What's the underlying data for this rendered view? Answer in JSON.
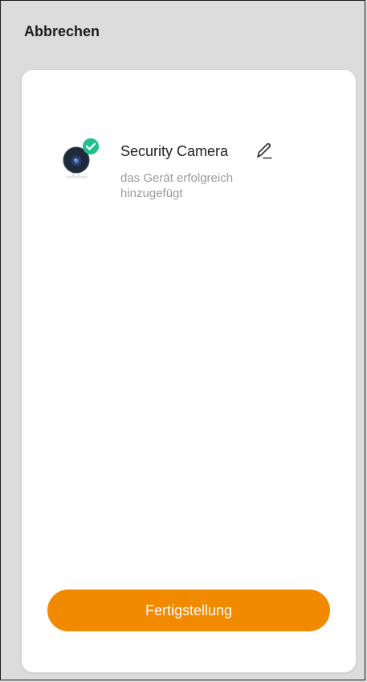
{
  "header": {
    "cancel_label": "Abbrechen"
  },
  "device": {
    "name": "Security Camera",
    "status": "das Gerät erfolgreich hinzugefügt",
    "icon": "security-camera-icon",
    "badge_icon": "checkmark-badge-icon",
    "edit_icon": "pencil-icon"
  },
  "footer": {
    "finish_label": "Fertigstellung"
  },
  "colors": {
    "background": "#dcdcdc",
    "card": "#ffffff",
    "accent": "#f28a00",
    "success": "#1fc08a",
    "secondary_text": "#9b9b9b"
  }
}
